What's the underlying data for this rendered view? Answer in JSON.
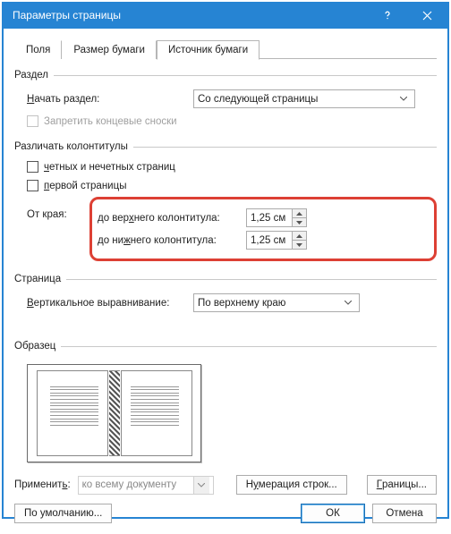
{
  "title": "Параметры страницы",
  "tabs": {
    "fields": "Поля",
    "paper_size": "Размер бумаги",
    "paper_source": "Источник бумаги"
  },
  "section": {
    "label": "Раздел",
    "section_start_label": "Начать раздел:",
    "section_start_value": "Со следующей страницы",
    "suppress_endnotes": "Запретить концевые сноски"
  },
  "headers_footers": {
    "label": "Различать колонтитулы",
    "diff_odd_even": "четных и нечетных страниц",
    "diff_first": "первой страницы",
    "from_edge_label": "От края:",
    "header_label": "до верхнего колонтитула:",
    "header_value": "1,25 см",
    "footer_label": "до нижнего колонтитула:",
    "footer_value": "1,25 см"
  },
  "page": {
    "label": "Страница",
    "valign_label": "Вертикальное выравнивание:",
    "valign_value": "По верхнему краю"
  },
  "preview": {
    "label": "Образец"
  },
  "apply": {
    "label": "Применить:",
    "value": "ко всему документу",
    "line_numbers": "Нумерация строк...",
    "borders": "Границы..."
  },
  "footer": {
    "default": "По умолчанию...",
    "ok": "ОК",
    "cancel": "Отмена"
  }
}
